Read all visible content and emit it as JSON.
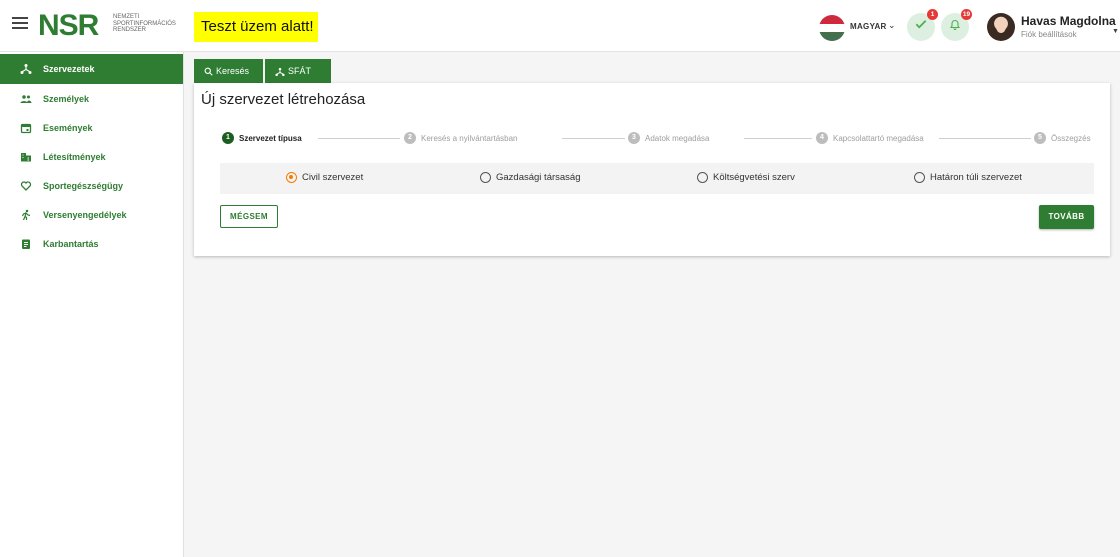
{
  "header": {
    "logo": "NSR",
    "logo_subtitle": [
      "NEMZETI",
      "SPORTINFORMÁCIÓS",
      "RENDSZER"
    ],
    "test_banner": "Teszt üzem alatt!",
    "language": "MAGYAR",
    "tasks_badge": "1",
    "notifications_badge": "19",
    "user_name": "Havas Magdolna",
    "user_sub": "Fiók beállítások"
  },
  "sidebar": {
    "items": [
      {
        "label": "Szervezetek",
        "icon": "organization-tree-icon",
        "active": true
      },
      {
        "label": "Személyek",
        "icon": "people-icon"
      },
      {
        "label": "Események",
        "icon": "calendar-icon"
      },
      {
        "label": "Létesítmények",
        "icon": "buildings-icon"
      },
      {
        "label": "Sportegészségügy",
        "icon": "heart-icon"
      },
      {
        "label": "Versenyengedélyek",
        "icon": "runner-icon"
      },
      {
        "label": "Karbantartás",
        "icon": "clipboard-icon"
      }
    ]
  },
  "tabs": [
    {
      "label": "Keresés",
      "icon": "search-icon"
    },
    {
      "label": "SFÁT",
      "icon": "organization-tree-icon"
    }
  ],
  "card": {
    "title": "Új szervezet létrehozása",
    "steps": [
      {
        "num": "1",
        "label": "Szervezet típusa",
        "active": true
      },
      {
        "num": "2",
        "label": "Keresés a nyilvántartásban"
      },
      {
        "num": "3",
        "label": "Adatok megadása"
      },
      {
        "num": "4",
        "label": "Kapcsolattartó megadása"
      },
      {
        "num": "5",
        "label": "Összegzés"
      }
    ],
    "options": [
      {
        "label": "Civil szervezet",
        "checked": true
      },
      {
        "label": "Gazdasági társaság"
      },
      {
        "label": "Költségvetési szerv"
      },
      {
        "label": "Határon túli szervezet"
      }
    ],
    "cancel_label": "MÉGSEM",
    "next_label": "TOVÁBB"
  },
  "colors": {
    "primary": "#2e7d32",
    "radio_checked": "#f57c00",
    "banner": "#ffff00"
  }
}
